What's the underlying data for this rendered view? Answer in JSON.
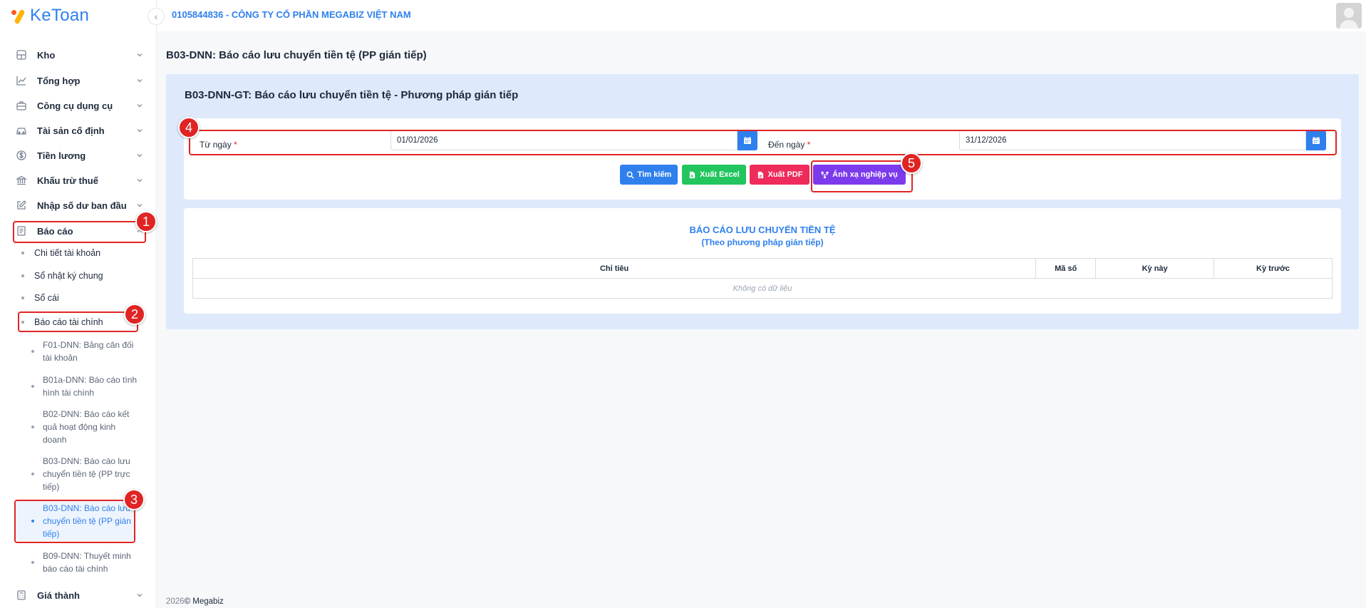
{
  "app": {
    "logo_text": "KeToan"
  },
  "header": {
    "company": "0105844836 - CÔNG TY CỔ PHẦN MEGABIZ VIỆT NAM"
  },
  "sidebar": {
    "menu": [
      {
        "label": "Kho",
        "icon": "warehouse-icon"
      },
      {
        "label": "Tổng hợp",
        "icon": "chart-line-icon"
      },
      {
        "label": "Công cụ dụng cụ",
        "icon": "toolbox-icon"
      },
      {
        "label": "Tài sản cố định",
        "icon": "car-icon"
      },
      {
        "label": "Tiền lương",
        "icon": "dollar-icon"
      },
      {
        "label": "Khấu trừ thuế",
        "icon": "bank-icon"
      },
      {
        "label": "Nhập số dư ban đầu",
        "icon": "edit-icon"
      },
      {
        "label": "Báo cáo",
        "icon": "report-icon"
      }
    ],
    "bao_cao_items": [
      "Chi tiết tài khoản",
      "Sổ nhật ký chung",
      "Sổ cái",
      "Báo cáo tài chính"
    ],
    "bctc_items": [
      "F01-DNN: Bảng cân đối tài khoản",
      "B01a-DNN: Báo cáo tình hình tài chính",
      "B02-DNN: Báo cáo kết quả hoạt động kinh doanh",
      "B03-DNN: Báo cáo lưu chuyển tiền tệ (PP trực tiếp)",
      "B03-DNN: Báo cáo lưu chuyển tiền tệ (PP gián tiếp)",
      "B09-DNN: Thuyết minh báo cáo tài chính"
    ],
    "last_item": "Giá thành"
  },
  "page": {
    "title": "B03-DNN: Báo cáo lưu chuyển tiền tệ (PP gián tiếp)",
    "card_title": "B03-DNN-GT: Báo cáo lưu chuyển tiền tệ - Phương pháp gián tiếp"
  },
  "filter": {
    "from_label": "Từ ngày",
    "from_value": "01/01/2026",
    "to_label": "Đến ngày",
    "to_value": "31/12/2026",
    "required_mark": "*"
  },
  "buttons": {
    "search": "Tìm kiếm",
    "excel": "Xuất Excel",
    "pdf": "Xuất PDF",
    "mapping": "Ánh xạ nghiệp vụ"
  },
  "report": {
    "title": "BÁO CÁO LƯU CHUYỂN TIỀN TỆ",
    "subtitle": "(Theo phương pháp gián tiếp)",
    "columns": [
      "Chỉ tiêu",
      "Mã số",
      "Kỳ này",
      "Kỳ trước"
    ],
    "empty": "Không có dữ liệu"
  },
  "annotations": [
    "1",
    "2",
    "3",
    "4",
    "5"
  ],
  "footer": {
    "year": "2026",
    "copyright": "©",
    "brand": "Megabiz"
  },
  "colors": {
    "primary": "#2f80ed",
    "success": "#22c55e",
    "danger": "#ef2b5b",
    "purple": "#7c3aed",
    "annotation": "#e02424"
  }
}
